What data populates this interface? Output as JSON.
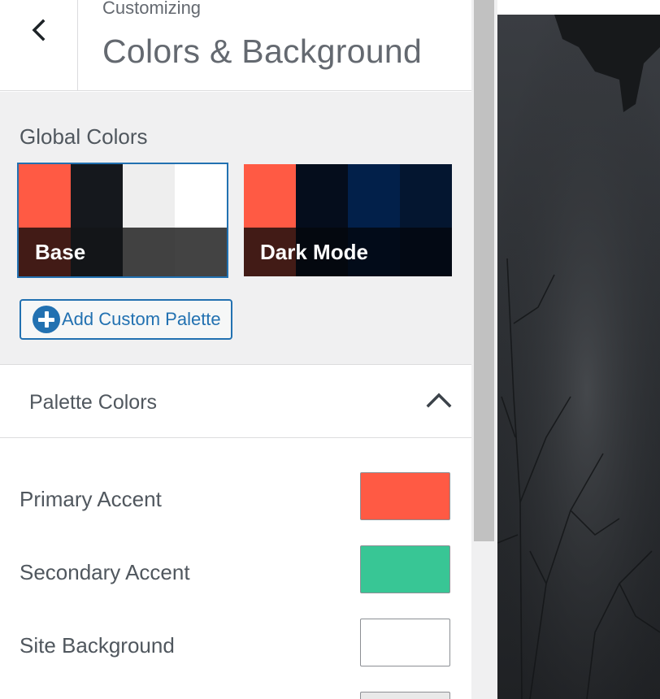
{
  "header": {
    "back_icon": "chevron-left-icon",
    "subtitle": "Customizing",
    "title": "Colors & Background"
  },
  "global_colors": {
    "title": "Global Colors",
    "palettes": [
      {
        "label": "Base",
        "selected": true,
        "top_colors": [
          "#ff5a44",
          "#15181d",
          "#eeeeee",
          "#ffffff"
        ],
        "bottom_colors": [
          "#421b16",
          "#131518",
          "#414141",
          "#434343"
        ]
      },
      {
        "label": "Dark Mode",
        "selected": false,
        "top_colors": [
          "#ff5a44",
          "#050d1c",
          "#02204a",
          "#041630"
        ],
        "bottom_colors": [
          "#421b16",
          "#04080f",
          "#020b19",
          "#030914"
        ]
      }
    ],
    "add_button_label": "Add Custom Palette",
    "add_icon": "plus-circle-icon"
  },
  "palette_colors": {
    "title": "Palette Colors",
    "collapse_icon": "chevron-up-icon",
    "items": [
      {
        "label": "Primary Accent",
        "color": "#ff5a44"
      },
      {
        "label": "Secondary Accent",
        "color": "#38c695"
      },
      {
        "label": "Site Background",
        "color": "#ffffff"
      }
    ]
  }
}
